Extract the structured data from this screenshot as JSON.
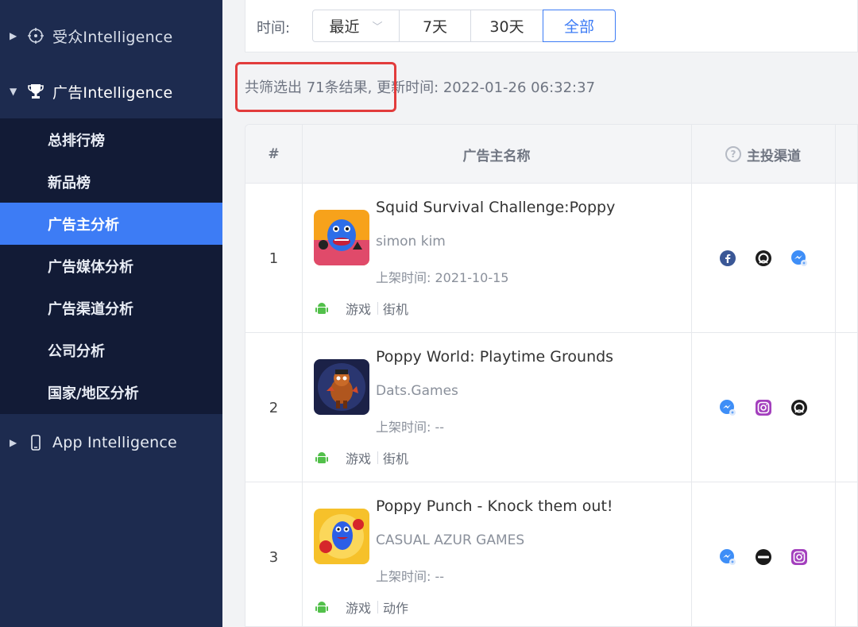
{
  "sidebar": {
    "sections": [
      {
        "label": "受众Intelligence",
        "icon": "crosshair-icon",
        "expanded": false
      },
      {
        "label": "广告Intelligence",
        "icon": "trophy-icon",
        "expanded": true
      },
      {
        "label": "App Intelligence",
        "icon": "phone-icon",
        "expanded": false
      }
    ],
    "sub_items": [
      "总排行榜",
      "新品榜",
      "广告主分析",
      "广告媒体分析",
      "广告渠道分析",
      "公司分析",
      "国家/地区分析"
    ],
    "active_sub_item": "广告主分析"
  },
  "filter": {
    "label": "时间:",
    "options": [
      "最近",
      "7天",
      "30天",
      "全部"
    ],
    "selected": "全部"
  },
  "summary": "共筛选出 71条结果, 更新时间: 2022-01-26 06:32:37",
  "table": {
    "headers": {
      "index": "#",
      "name": "广告主名称",
      "channels": "主投渠道"
    },
    "rows": [
      {
        "index": "1",
        "title": "Squid Survival Challenge:Poppy",
        "developer": "simon kim",
        "release": "上架时间: 2021-10-15",
        "platform_icon": "android-icon",
        "category": "游戏",
        "genre": "街机",
        "channels": [
          "facebook-icon",
          "ad-network-icon",
          "messenger-icon"
        ]
      },
      {
        "index": "2",
        "title": "Poppy World: Playtime Grounds",
        "developer": "Dats.Games",
        "release": "上架时间: --",
        "platform_icon": "android-icon",
        "category": "游戏",
        "genre": "街机",
        "channels": [
          "messenger-icon",
          "instagram-icon",
          "ad-network-icon"
        ]
      },
      {
        "index": "3",
        "title": "Poppy Punch - Knock them out!",
        "developer": "CASUAL AZUR GAMES",
        "release": "上架时间: --",
        "platform_icon": "android-icon",
        "category": "游戏",
        "genre": "动作",
        "channels": [
          "messenger-icon",
          "vungle-icon",
          "instagram-icon"
        ]
      }
    ]
  },
  "colors": {
    "sidebar_bg": "#1d2b4f",
    "submenu_bg": "#121b36",
    "active": "#3d7cf5",
    "highlight_border": "#e23c3c"
  }
}
